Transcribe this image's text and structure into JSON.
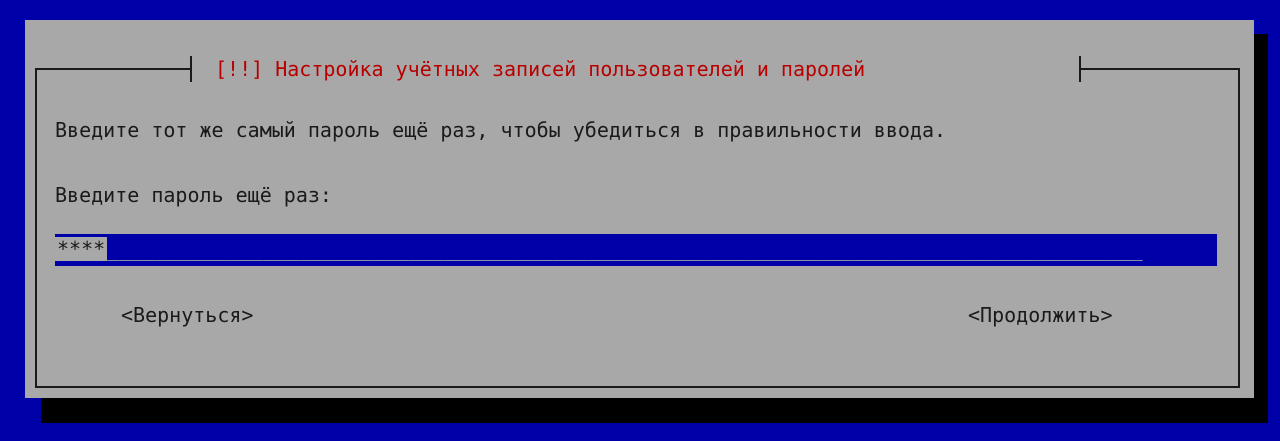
{
  "dialog": {
    "title": "[!!] Настройка учётных записей пользователей и паролей",
    "description": "Введите тот же самый пароль ещё раз, чтобы убедиться в правильности ввода.",
    "prompt": "Введите пароль ещё раз:",
    "password_field": {
      "value": "****",
      "filler": "______________________________________________________________________________________"
    },
    "buttons": {
      "back": "<Вернуться>",
      "continue": "<Продолжить>"
    }
  },
  "colors": {
    "background": "#0000a8",
    "dialog": "#a8a8a8",
    "title": "#b80000",
    "shadow": "#000000"
  }
}
